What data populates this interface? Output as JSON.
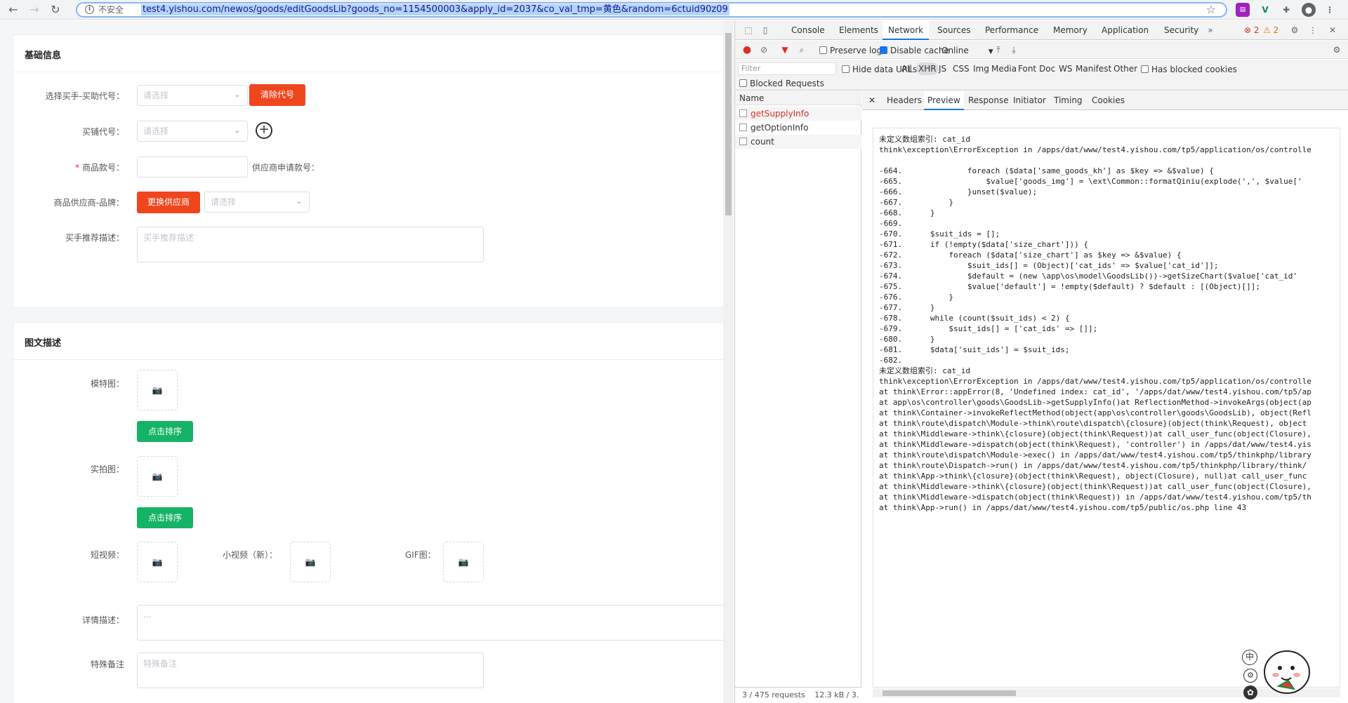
{
  "browser": {
    "security_label": "不安全",
    "url": "test4.yishou.com/newos/goods/editGoodsLib?goods_no=1154500003&apply_id=2037&co_val_tmp=黄色&random=6ctuid90z09"
  },
  "form": {
    "section1_title": "基础信息",
    "buyer_code_label": "选择买手-买助代号：",
    "buyer_code_placeholder": "请选择",
    "clear_code_label": "清除代号",
    "shop_code_label": "买铺代号：",
    "shop_code_placeholder": "请选择",
    "item_no_label": "商品款号：",
    "supplier_apply_label": "供应商申请款号：",
    "supplier_brand_label": "商品供应商-品牌：",
    "change_supplier_label": "更换供应商",
    "brand_placeholder": "请选择",
    "recommend_label": "买手推荐描述：",
    "recommend_placeholder": "买手推荐描述",
    "section2_title": "图文描述",
    "model_img_label": "模特图：",
    "sort_label_1": "点击排序",
    "real_img_label": "实拍图：",
    "sort_label_2": "点击排序",
    "short_video_label": "短视频：",
    "small_video_label": "小视频（新）：",
    "gif_label": "GIF图：",
    "detail_label": "详情描述：",
    "detail_placeholder": "...",
    "remark_label": "特殊备注",
    "remark_placeholder": "特殊备注"
  },
  "devtools": {
    "tabs": [
      "Console",
      "Elements",
      "Network",
      "Sources",
      "Performance",
      "Memory",
      "Application",
      "Security"
    ],
    "active_tab": "Network",
    "errors_count": "2",
    "warnings_count": "2",
    "preserve_log": "Preserve log",
    "disable_cache": "Disable cache",
    "throttle": "Online",
    "filter_placeholder": "Filter",
    "hide_data_urls": "Hide data URLs",
    "type_filters": [
      "All",
      "XHR",
      "JS",
      "CSS",
      "Img",
      "Media",
      "Font",
      "Doc",
      "WS",
      "Manifest",
      "Other"
    ],
    "active_type": "XHR",
    "has_blocked_cookies": "Has blocked cookies",
    "blocked_requests": "Blocked Requests",
    "name_header": "Name",
    "requests": [
      {
        "name": "getSupplyInfo",
        "error": true
      },
      {
        "name": "getOptionInfo",
        "error": false
      },
      {
        "name": "count",
        "error": false
      }
    ],
    "preview_tabs": [
      "Headers",
      "Preview",
      "Response",
      "Initiator",
      "Timing",
      "Cookies"
    ],
    "active_preview_tab": "Preview",
    "status_requests": "3 / 475 requests",
    "status_size": "12.3 kB / 3.",
    "preview_lines": [
      "未定义数组索引: cat_id",
      "think\\exception\\ErrorException in /apps/dat/www/test4.yishou.com/tp5/application/os/controlle",
      "",
      "-664.              foreach ($data['same_goods_kh'] as $key => &$value) {",
      "-665.                  $value['goods_img'] = \\ext\\Common::formatQiniu(explode(',', $value['",
      "-666.              }unset($value);",
      "-667.          }",
      "-668.      }",
      "-669.",
      "-670.      $suit_ids = [];",
      "-671.      if (!empty($data['size_chart'])) {",
      "-672.          foreach ($data['size_chart'] as $key => &$value) {",
      "-673.              $suit_ids[] = (Object)['cat_ids' => $value['cat_id']];",
      "-674.              $default = (new \\app\\os\\model\\GoodsLib())->getSizeChart($value['cat_id'",
      "-675.              $value['default'] = !empty($default) ? $default : [(Object)[]];",
      "-676.          }",
      "-677.      }",
      "-678.      while (count($suit_ids) < 2) {",
      "-679.          $suit_ids[] = ['cat_ids' => []];",
      "-680.      }",
      "-681.      $data['suit_ids'] = $suit_ids;",
      "-682.",
      "未定义数组索引: cat_id",
      "think\\exception\\ErrorException in /apps/dat/www/test4.yishou.com/tp5/application/os/controlle",
      "at think\\Error::appError(8, 'Undefined index: cat_id', '/apps/dat/www/test4.yishou.com/tp5/ap",
      "at app\\os\\controller\\goods\\GoodsLib->getSupplyInfo()at ReflectionMethod->invokeArgs(object(ap",
      "at think\\Container->invokeReflectMethod(object(app\\os\\controller\\goods\\GoodsLib), object(Refl",
      "at think\\route\\dispatch\\Module->think\\route\\dispatch\\{closure}(object(think\\Request), object",
      "at think\\Middleware->think\\{closure}(object(think\\Request))at call_user_func(object(Closure),",
      "at think\\Middleware->dispatch(object(think\\Request), 'controller') in /apps/dat/www/test4.yis",
      "at think\\route\\dispatch\\Module->exec() in /apps/dat/www/test4.yishou.com/tp5/thinkphp/library",
      "at think\\route\\Dispatch->run() in /apps/dat/www/test4.yishou.com/tp5/thinkphp/library/think/",
      "at think\\App->think\\{closure}(object(think\\Request), object(Closure), null)at call_user_func",
      "at think\\Middleware->think\\{closure}(object(think\\Request))at call_user_func(object(Closure),",
      "at think\\Middleware->dispatch(object(think\\Request)) in /apps/dat/www/test4.yishou.com/tp5/th",
      "at think\\App->run() in /apps/dat/www/test4.yishou.com/tp5/public/os.php line 43"
    ]
  },
  "widget": {
    "ime_label": "中"
  },
  "colors": {
    "accent_red": "#f0461e",
    "accent_green": "#15b366",
    "devtools_blue": "#1a73e8"
  }
}
